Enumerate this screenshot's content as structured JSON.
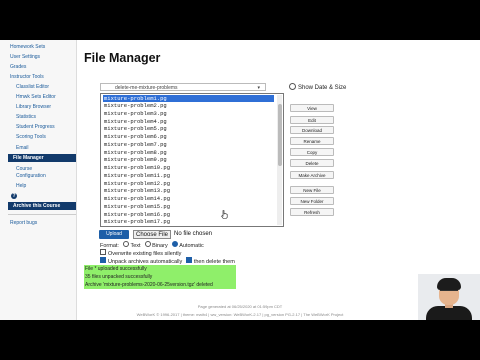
{
  "page": {
    "title": "File Manager"
  },
  "sidebar": {
    "items": [
      {
        "label": "Homework Sets"
      },
      {
        "label": "User Settings"
      },
      {
        "label": "Grades"
      },
      {
        "label": "Instructor Tools"
      },
      {
        "label": "Classlist Editor"
      },
      {
        "label": "Hmwk Sets Editor"
      },
      {
        "label": "Library Browser"
      },
      {
        "label": "Statistics"
      },
      {
        "label": "Student Progress"
      },
      {
        "label": "Scoring Tools"
      },
      {
        "label": "Email"
      },
      {
        "label": "File Manager"
      },
      {
        "label": "Course"
      },
      {
        "label": "Configuration"
      },
      {
        "label": "Help"
      },
      {
        "label": "Archive this Course"
      },
      {
        "label": "Report bugs"
      }
    ],
    "help_icon": "?"
  },
  "directory": {
    "selected": "delete-me-mixture-problems",
    "chevron": "▾"
  },
  "show_date": {
    "label": "Show Date & Size"
  },
  "files": [
    "mixture-problem1.pg",
    "mixture-problem2.pg",
    "mixture-problem3.pg",
    "mixture-problem4.pg",
    "mixture-problem5.pg",
    "mixture-problem6.pg",
    "mixture-problem7.pg",
    "mixture-problem8.pg",
    "mixture-problem9.pg",
    "mixture-problem10.pg",
    "mixture-problem11.pg",
    "mixture-problem12.pg",
    "mixture-problem13.pg",
    "mixture-problem14.pg",
    "mixture-problem15.pg",
    "mixture-problem16.pg",
    "mixture-problem17.pg"
  ],
  "selected_file": "mixture-problem1.pg",
  "actions": {
    "view": "View",
    "edit": "Edit",
    "download": "Download",
    "rename": "Rename",
    "copy": "Copy",
    "delete": "Delete",
    "make_archive": "Make Archive",
    "new_file": "New File",
    "new_folder": "New Folder",
    "refresh": "Refresh"
  },
  "upload": {
    "button": "Upload",
    "choose_file": "Choose File",
    "no_file": "No file chosen",
    "format_label": "Format:",
    "format_text": "Text",
    "format_binary": "Binary",
    "format_automatic": "Automatic",
    "format_selected": "Automatic",
    "overwrite": "Overwrite existing files silently",
    "overwrite_checked": false,
    "unpack": "Unpack archives automatically",
    "unpack_checked": true,
    "delete_them": "then delete them",
    "delete_checked": true
  },
  "messages": [
    "File * uploaded successfully",
    "35 files unpacked successfully",
    "Archive 'mixture-problems-2020-06-25version.tgz' deleted"
  ],
  "footer": {
    "generated": "Page generated at 06/25/2020 at 01:59pm CDT",
    "credits": "WeBWorK © 1996-2017 | theme: math4 | ww_version: WeBWorK-2.17 | pg_version PG-2.17 | The WeBWorK Project"
  },
  "colors": {
    "nav_active": "#123a6b",
    "upload_button": "#1e5fa8",
    "selection": "#2f6fd6",
    "message_bg": "#8fef6a"
  }
}
